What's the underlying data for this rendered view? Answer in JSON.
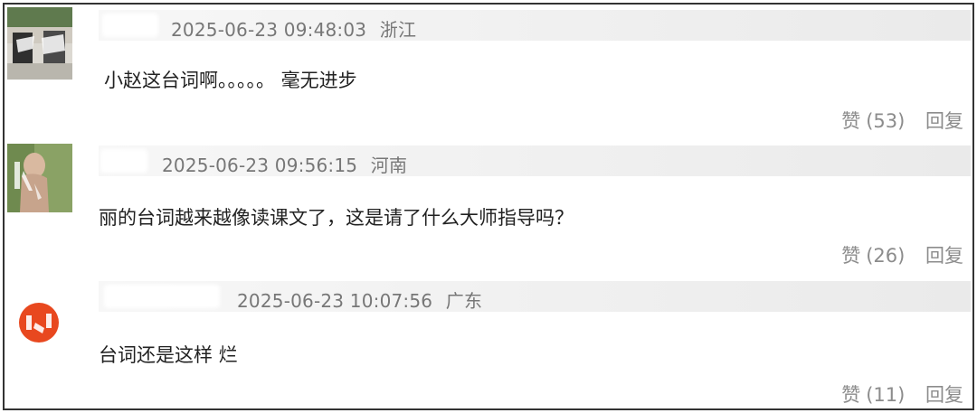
{
  "comments": [
    {
      "timestamp": "2025-06-23 09:48:03",
      "location": "浙江",
      "text": "小赵这台词啊。。。。。 毫无进步",
      "like_label": "赞",
      "like_count": "(53)",
      "reply_label": "回复"
    },
    {
      "timestamp": "2025-06-23 09:56:15",
      "location": "河南",
      "text": "丽的台词越来越像读课文了，这是请了什么大师指导吗？",
      "like_label": "赞",
      "like_count": "(26)",
      "reply_label": "回复"
    },
    {
      "timestamp": "2025-06-23 10:07:56",
      "location": "广东",
      "text": "台词还是这样 烂",
      "like_label": "赞",
      "like_count": "(11)",
      "reply_label": "回复"
    }
  ],
  "colors": {
    "border": "#333333",
    "meta_text": "#777777",
    "body_text": "#222222",
    "action_text": "#8c8c8c",
    "avatar3_accent": "#e8481f"
  }
}
